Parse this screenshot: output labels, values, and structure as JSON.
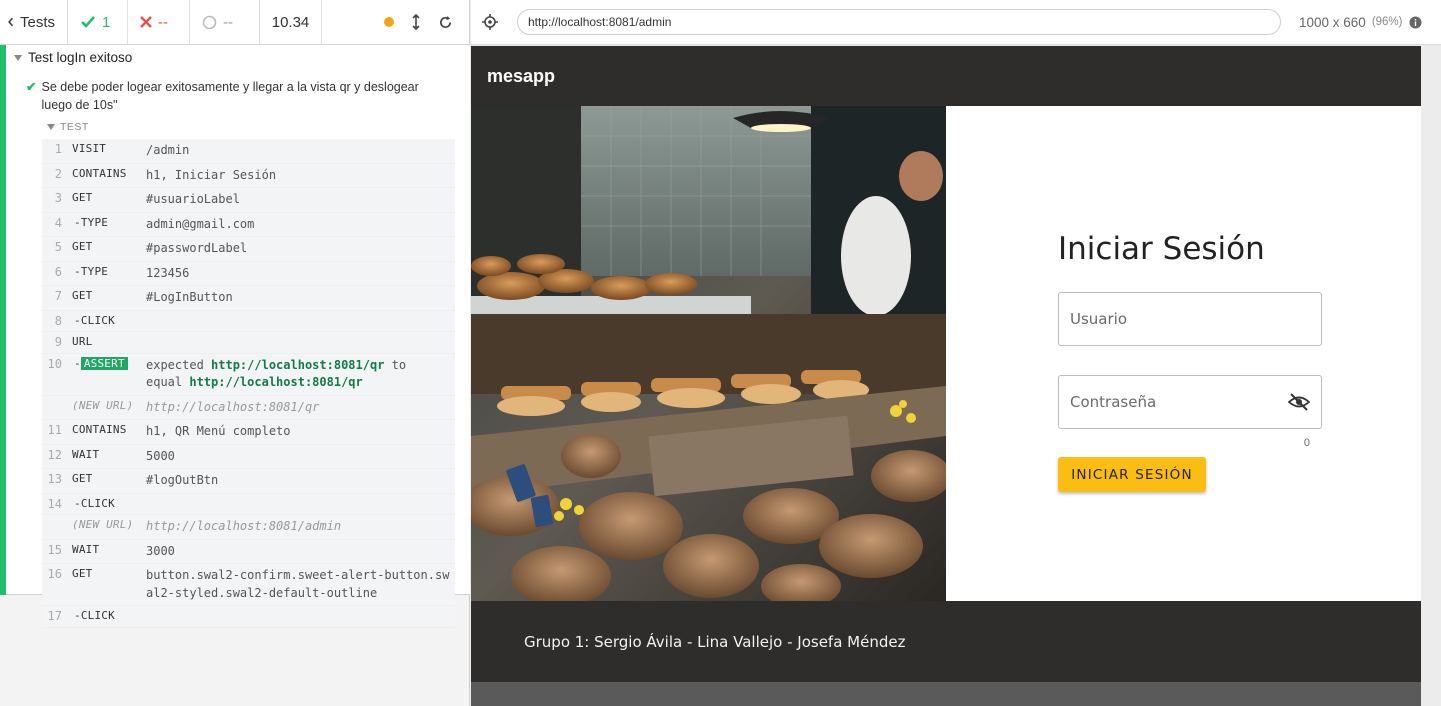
{
  "reporter": {
    "tests_label": "Tests",
    "passed": "1",
    "failed": "--",
    "pending": "--",
    "duration": "10.34",
    "suite_title": "Test logIn exitoso",
    "test_title": "Se debe poder logear exitosamente y llegar a la vista qr y deslogear luego de 10s\"",
    "section_label": "TEST",
    "commands": [
      {
        "num": "1",
        "name": "VISIT",
        "msg": "/admin"
      },
      {
        "num": "2",
        "name": "CONTAINS",
        "msg": "h1, Iniciar Sesión"
      },
      {
        "num": "3",
        "name": "GET",
        "msg": "#usuarioLabel"
      },
      {
        "num": "4",
        "name": "-TYPE",
        "msg": "admin@gmail.com"
      },
      {
        "num": "5",
        "name": "GET",
        "msg": "#passwordLabel"
      },
      {
        "num": "6",
        "name": "-TYPE",
        "msg": "123456"
      },
      {
        "num": "7",
        "name": "GET",
        "msg": "#LogInButton"
      },
      {
        "num": "8",
        "name": "-CLICK",
        "msg": ""
      },
      {
        "num": "9",
        "name": "URL",
        "msg": ""
      },
      {
        "num": "10",
        "name": "ASSERT",
        "msg_expected": "expected",
        "msg_url1": "http://localhost:8081/qr",
        "msg_to": "to",
        "msg_equal": "equal",
        "msg_url2": "http://localhost:8081/qr"
      },
      {
        "num": "",
        "name": "(NEW URL)",
        "msg": "http://localhost:8081/qr"
      },
      {
        "num": "11",
        "name": "CONTAINS",
        "msg": "h1, QR Menú completo"
      },
      {
        "num": "12",
        "name": "WAIT",
        "msg": "5000"
      },
      {
        "num": "13",
        "name": "GET",
        "msg": "#logOutBtn"
      },
      {
        "num": "14",
        "name": "-CLICK",
        "msg": ""
      },
      {
        "num": "",
        "name": "(NEW URL)",
        "msg": "http://localhost:8081/admin"
      },
      {
        "num": "15",
        "name": "WAIT",
        "msg": "3000"
      },
      {
        "num": "16",
        "name": "GET",
        "msg": "button.swal2-confirm.sweet-alert-button.swal2-styled.swal2-default-outline"
      },
      {
        "num": "17",
        "name": "-CLICK",
        "msg": ""
      }
    ]
  },
  "preview": {
    "url": "http://localhost:8081/admin",
    "viewport": "1000 x 660",
    "scale": "(96%)"
  },
  "app": {
    "brand": "mesapp",
    "login_title": "Iniciar Sesión",
    "user_placeholder": "Usuario",
    "password_placeholder": "Contraseña",
    "char_counter": "0",
    "login_button": "INICIAR SESIÓN",
    "footer_text": "Grupo 1: Sergio Ávila - Lina Vallejo - Josefa Méndez"
  },
  "colors": {
    "pass": "#1fbf6b",
    "fail": "#e94f4f",
    "accent_button": "#fcbd12",
    "nav_bg": "#2f2d2c"
  }
}
